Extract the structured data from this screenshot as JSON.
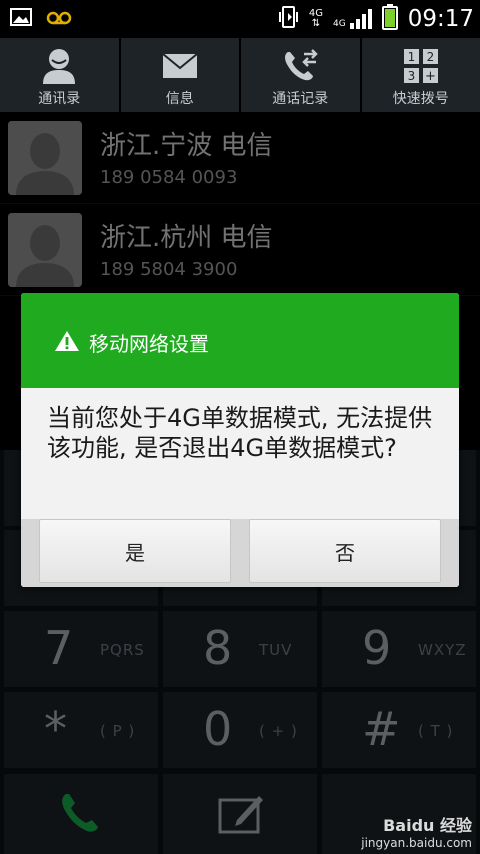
{
  "status_bar": {
    "network_top": "4G",
    "network_small": "4G",
    "time": "09:17"
  },
  "tabs": [
    {
      "label": "通讯录",
      "icon": "contacts-icon"
    },
    {
      "label": "信息",
      "icon": "message-icon"
    },
    {
      "label": "通话记录",
      "icon": "call-log-icon"
    },
    {
      "label": "快速拨号",
      "icon": "speed-dial-icon"
    }
  ],
  "contacts": [
    {
      "name": "浙江.宁波 电信",
      "number": "189 0584 0093"
    },
    {
      "name": "浙江.杭州 电信",
      "number": "189 5804 3900"
    }
  ],
  "dialpad": {
    "keys": [
      {
        "digit": "7",
        "letters": "PQRS"
      },
      {
        "digit": "8",
        "letters": "TUV"
      },
      {
        "digit": "9",
        "letters": "WXYZ"
      },
      {
        "digit": "*",
        "letters": "( P )"
      },
      {
        "digit": "0",
        "letters": "( + )"
      },
      {
        "digit": "#",
        "letters": "( T )"
      }
    ]
  },
  "dialog": {
    "title": "移动网络设置",
    "message": "当前您处于4G单数据模式, 无法提供该功能, 是否退出4G单数据模式?",
    "yes_label": "是",
    "no_label": "否",
    "header_color": "#1faa1f"
  },
  "watermark": {
    "brand": "Baidu 经验",
    "url": "jingyan.baidu.com"
  }
}
